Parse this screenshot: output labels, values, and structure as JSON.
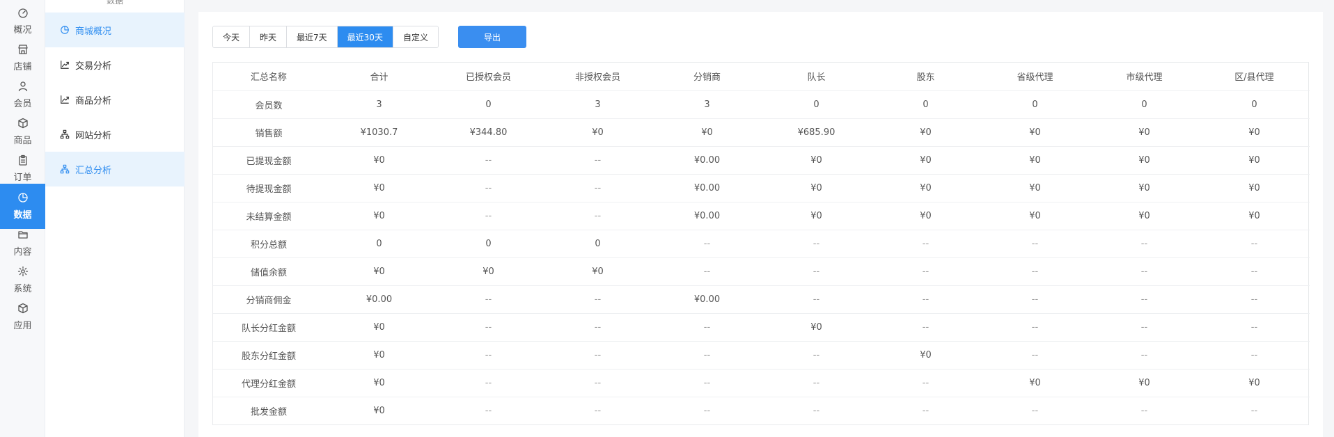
{
  "rail": [
    {
      "key": "overview",
      "label": "概况",
      "icon": "dashboard-icon"
    },
    {
      "key": "store",
      "label": "店铺",
      "icon": "store-icon"
    },
    {
      "key": "member",
      "label": "会员",
      "icon": "user-icon"
    },
    {
      "key": "goods",
      "label": "商品",
      "icon": "box-icon"
    },
    {
      "key": "orders",
      "label": "订单",
      "icon": "clipboard-icon"
    },
    {
      "key": "data",
      "label": "数据",
      "icon": "pie-chart-icon",
      "active": true
    },
    {
      "key": "content",
      "label": "内容",
      "icon": "folder-icon"
    },
    {
      "key": "system",
      "label": "系统",
      "icon": "gear-icon"
    },
    {
      "key": "apps",
      "label": "应用",
      "icon": "cube-icon"
    }
  ],
  "subnav": {
    "top_label": "数据",
    "items": [
      {
        "label": "商城概况",
        "icon": "pie-chart-icon",
        "selected": true
      },
      {
        "label": "交易分析",
        "icon": "trend-icon"
      },
      {
        "label": "商品分析",
        "icon": "trend-icon"
      },
      {
        "label": "网站分析",
        "icon": "org-chart-icon"
      },
      {
        "label": "汇总分析",
        "icon": "org-chart-icon",
        "selected": true
      }
    ]
  },
  "toolbar": {
    "ranges": [
      "今天",
      "昨天",
      "最近7天",
      "最近30天",
      "自定义"
    ],
    "active_range": "最近30天",
    "export_label": "导出"
  },
  "table": {
    "columns": [
      "汇总名称",
      "合计",
      "已授权会员",
      "非授权会员",
      "分销商",
      "队长",
      "股东",
      "省级代理",
      "市级代理",
      "区/县代理"
    ],
    "rows": [
      [
        "会员数",
        "3",
        "0",
        "3",
        "3",
        "0",
        "0",
        "0",
        "0",
        "0"
      ],
      [
        "销售额",
        "¥1030.7",
        "¥344.80",
        "¥0",
        "¥0",
        "¥685.90",
        "¥0",
        "¥0",
        "¥0",
        "¥0"
      ],
      [
        "已提现金额",
        "¥0",
        "--",
        "--",
        "¥0.00",
        "¥0",
        "¥0",
        "¥0",
        "¥0",
        "¥0"
      ],
      [
        "待提现金额",
        "¥0",
        "--",
        "--",
        "¥0.00",
        "¥0",
        "¥0",
        "¥0",
        "¥0",
        "¥0"
      ],
      [
        "未结算金额",
        "¥0",
        "--",
        "--",
        "¥0.00",
        "¥0",
        "¥0",
        "¥0",
        "¥0",
        "¥0"
      ],
      [
        "积分总额",
        "0",
        "0",
        "0",
        "--",
        "--",
        "--",
        "--",
        "--",
        "--"
      ],
      [
        "储值余额",
        "¥0",
        "¥0",
        "¥0",
        "--",
        "--",
        "--",
        "--",
        "--",
        "--"
      ],
      [
        "分销商佣金",
        "¥0.00",
        "--",
        "--",
        "¥0.00",
        "--",
        "--",
        "--",
        "--",
        "--"
      ],
      [
        "队长分红金额",
        "¥0",
        "--",
        "--",
        "--",
        "¥0",
        "--",
        "--",
        "--",
        "--"
      ],
      [
        "股东分红金额",
        "¥0",
        "--",
        "--",
        "--",
        "--",
        "¥0",
        "--",
        "--",
        "--"
      ],
      [
        "代理分红金额",
        "¥0",
        "--",
        "--",
        "--",
        "--",
        "--",
        "¥0",
        "¥0",
        "¥0"
      ],
      [
        "批发金额",
        "¥0",
        "--",
        "--",
        "--",
        "--",
        "--",
        "--",
        "--",
        "--"
      ]
    ]
  },
  "colors": {
    "accent": "#2d8cf0",
    "selected_bg": "#e8f3fd"
  }
}
